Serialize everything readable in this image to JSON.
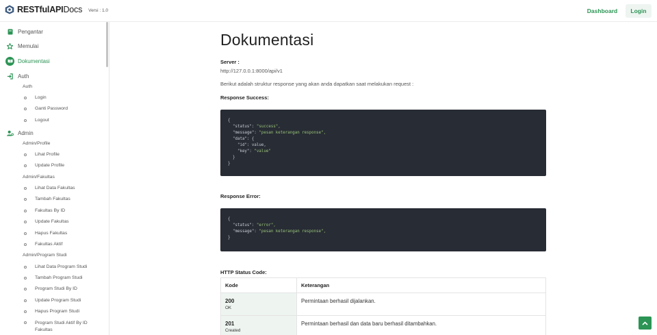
{
  "header": {
    "brand_strong": "RESTfulAPI",
    "brand_light": "Docs",
    "version": "Versi : 1.0",
    "nav": {
      "dashboard": "Dashboard",
      "login": "Login"
    }
  },
  "sidebar": {
    "items": [
      {
        "label": "Pengantar",
        "icon": "book-icon"
      },
      {
        "label": "Memulai",
        "icon": "star-icon"
      },
      {
        "label": "Dokumentasi",
        "icon": "book-open-icon",
        "active": true
      },
      {
        "label": "Auth",
        "icon": "sign-in-icon"
      },
      {
        "label": "Admin",
        "icon": "user-cog-icon"
      }
    ],
    "auth_group": "Auth",
    "auth_links": [
      "Login",
      "Ganti Password",
      "Logout"
    ],
    "admin_profile_group": "Admin/Profile",
    "admin_profile_links": [
      "Lihat Profile",
      "Update Profile"
    ],
    "admin_fakultas_group": "Admin/Fakultas",
    "admin_fakultas_links": [
      "Lihat Data Fakultas",
      "Tambah Fakultas",
      "Fakultas By ID",
      "Update Fakultas",
      "Hapus Fakultas",
      "Fakultas Aktif"
    ],
    "admin_prodi_group": "Admin/Program Studi",
    "admin_prodi_links": [
      "Lihat Data Program Studi",
      "Tambah Program Studi",
      "Program Studi By ID",
      "Update Program Studi",
      "Hapus Program Studi"
    ],
    "admin_prodi_last_line1": "Program Studi Aktif By ID",
    "admin_prodi_last_line2": "Fakultas"
  },
  "main": {
    "title": "Dokumentasi",
    "server_label": "Server :",
    "server_url": "http://127.0.0.1:8000/api/v1",
    "intro": "Berikut adalah struktur response yang akan anda dapatkan saat melakukan request :",
    "success_label": "Response Success:",
    "success_code": [
      {
        "k": "{",
        "s": ""
      },
      {
        "k": "  \"status\": ",
        "s": "\"success\","
      },
      {
        "k": "  \"message\": ",
        "s": "\"pesan keterangan response\","
      },
      {
        "k": "  \"data\": {",
        "s": ""
      },
      {
        "k": "    \"id\": value,",
        "s": ""
      },
      {
        "k": "    \"key\": ",
        "s": "\"value\""
      },
      {
        "k": "  }",
        "s": ""
      },
      {
        "k": "}",
        "s": ""
      }
    ],
    "error_label": "Response Error:",
    "error_code": [
      {
        "k": "{",
        "s": ""
      },
      {
        "k": "  \"status\": ",
        "s": "\"error\","
      },
      {
        "k": "  \"message\": ",
        "s": "\"pesan keterangan response\","
      },
      {
        "k": "}",
        "s": ""
      }
    ],
    "status_label": "HTTP Status Code:",
    "table": {
      "headers": [
        "Kode",
        "Keterangan"
      ],
      "rows": [
        {
          "code": "200",
          "text": "OK",
          "desc": "Permintaan berhasil dijalankan."
        },
        {
          "code": "201",
          "text": "Created",
          "desc": "Permintaan berhasil dan data baru berhasil ditambahkan."
        }
      ]
    }
  },
  "colors": {
    "accent": "#2c9455",
    "code_bg": "#282c34",
    "code_string": "#98c379"
  }
}
